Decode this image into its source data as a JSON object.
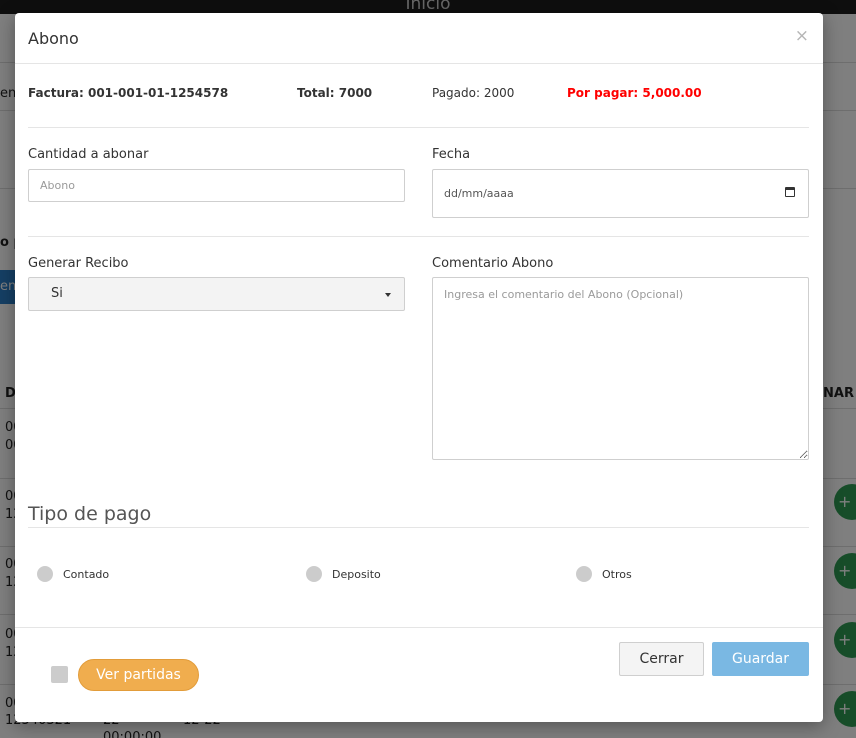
{
  "background": {
    "topbar_title": "Inicio",
    "fragment_left_1": "en",
    "fragment_left_2": "o p",
    "fragment_btn": "ent",
    "fragment_col_d": "D",
    "fragment_col_nar": "NAR",
    "fragment_rows": [
      "00",
      "00",
      "00",
      "12",
      "00",
      "12",
      "00",
      "12",
      "00"
    ],
    "fragment_bottom": [
      "12540321",
      "22",
      "12-22",
      "00:00:00"
    ],
    "fragment_plus": "+"
  },
  "modal": {
    "title": "Abono",
    "close_glyph": "×",
    "info": {
      "factura": "Factura: 001-001-01-1254578",
      "total": "Total: 7000",
      "pagado": "Pagado: 2000",
      "por_pagar": "Por pagar: 5,000.00",
      "por_pagar_color": "#ff0000"
    },
    "form": {
      "cantidad_label": "Cantidad a abonar",
      "cantidad_placeholder": "Abono",
      "fecha_label": "Fecha",
      "fecha_placeholder": "dd/mm/aaaa",
      "recibo_label": "Generar Recibo",
      "recibo_value": "Si",
      "comentario_label": "Comentario Abono",
      "comentario_placeholder": "Ingresa el comentario del Abono (Opcional)"
    },
    "tipo_pago": {
      "title": "Tipo de pago",
      "options": [
        "Contado",
        "Deposito",
        "Otros"
      ]
    },
    "footer": {
      "partidas_label": "Ver partidas",
      "cerrar_label": "Cerrar",
      "guardar_label": "Guardar"
    }
  }
}
